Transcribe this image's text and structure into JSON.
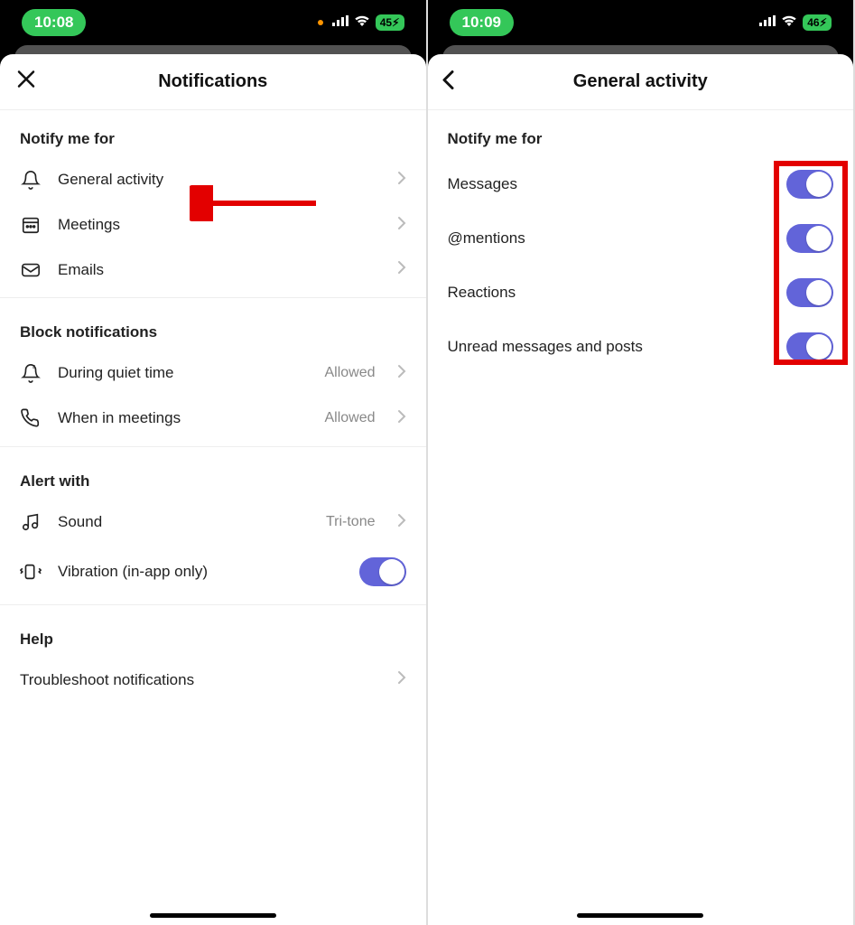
{
  "left": {
    "statusbar": {
      "time": "10:08",
      "battery": "45"
    },
    "header": {
      "title": "Notifications"
    },
    "sections": {
      "notify": {
        "title": "Notify me for",
        "items": [
          {
            "label": "General activity"
          },
          {
            "label": "Meetings"
          },
          {
            "label": "Emails"
          }
        ]
      },
      "block": {
        "title": "Block notifications",
        "items": [
          {
            "label": "During quiet time",
            "value": "Allowed"
          },
          {
            "label": "When in meetings",
            "value": "Allowed"
          }
        ]
      },
      "alert": {
        "title": "Alert with",
        "items": [
          {
            "label": "Sound",
            "value": "Tri-tone"
          },
          {
            "label": "Vibration (in-app only)"
          }
        ]
      },
      "help": {
        "title": "Help",
        "items": [
          {
            "label": "Troubleshoot notifications"
          }
        ]
      }
    }
  },
  "right": {
    "statusbar": {
      "time": "10:09",
      "battery": "46"
    },
    "header": {
      "title": "General activity"
    },
    "section": {
      "title": "Notify me for",
      "items": [
        {
          "label": "Messages"
        },
        {
          "label": "@mentions"
        },
        {
          "label": "Reactions"
        },
        {
          "label": "Unread messages and posts"
        }
      ]
    }
  }
}
